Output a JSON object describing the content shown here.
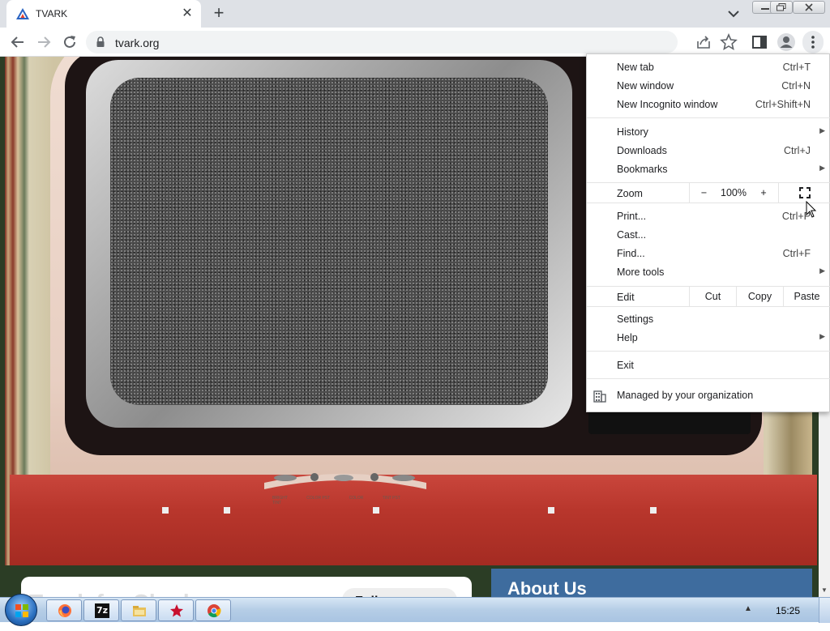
{
  "tab": {
    "title": "TVARK",
    "close_glyph": "✕",
    "new_tab_glyph": "+"
  },
  "omnibox": {
    "url": "tvark.org"
  },
  "page": {
    "tv_control_labels": [
      "BRIGHT",
      "COLOR PST",
      "COLOR",
      "TINT PST",
      "TINT"
    ],
    "brand_text": "Tvark for Chad",
    "follow_label": "Follow on Twitter",
    "about_heading": "About Us"
  },
  "menu": {
    "new_tab": {
      "label": "New tab",
      "shortcut": "Ctrl+T"
    },
    "new_window": {
      "label": "New window",
      "shortcut": "Ctrl+N"
    },
    "new_incognito": {
      "label": "New Incognito window",
      "shortcut": "Ctrl+Shift+N"
    },
    "history": {
      "label": "History"
    },
    "downloads": {
      "label": "Downloads",
      "shortcut": "Ctrl+J"
    },
    "bookmarks": {
      "label": "Bookmarks"
    },
    "zoom": {
      "label": "Zoom",
      "minus": "−",
      "level": "100%",
      "plus": "+"
    },
    "print": {
      "label": "Print...",
      "shortcut": "Ctrl+P"
    },
    "cast": {
      "label": "Cast..."
    },
    "find": {
      "label": "Find...",
      "shortcut": "Ctrl+F"
    },
    "more_tools": {
      "label": "More tools"
    },
    "edit": {
      "label": "Edit",
      "cut": "Cut",
      "copy": "Copy",
      "paste": "Paste"
    },
    "settings": {
      "label": "Settings"
    },
    "help": {
      "label": "Help"
    },
    "exit": {
      "label": "Exit"
    },
    "managed": {
      "label": "Managed by your organization"
    },
    "submenu_arrow": "▶"
  },
  "taskbar": {
    "clock": "15:25",
    "tray_arrow": "▲",
    "apps": [
      "firefox-icon",
      "7zip-icon",
      "file-explorer-icon",
      "red-star-app-icon",
      "chrome-icon"
    ],
    "sevenzip_text": "7z"
  },
  "colors": {
    "tab_strip": "#dee1e6",
    "table_red": "#b8362c",
    "about_blue": "#3e6c9e",
    "taskbar": "#b5cde6"
  }
}
